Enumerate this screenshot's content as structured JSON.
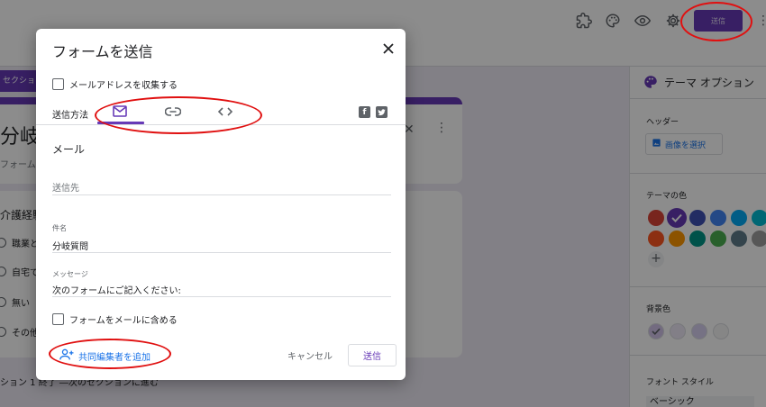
{
  "header": {
    "send_label": "送信",
    "icons": [
      "puzzle-icon",
      "palette-icon",
      "eye-icon",
      "gear-icon",
      "more-vert-icon"
    ]
  },
  "form": {
    "section_label": "セクション",
    "title": "分岐",
    "description": "フォームの",
    "question_title": "介護経験",
    "options": [
      "職業と",
      "自宅で",
      "無い",
      "その他"
    ],
    "section_note": "ション 1 終了 ―次のセクションに進む"
  },
  "theme_panel": {
    "title": "テーマ オプション",
    "header_label": "ヘッダー",
    "select_image_label": "画像を選択",
    "theme_color_label": "テーマの色",
    "theme_colors": [
      "#db4437",
      "#673ab7",
      "#3f51b5",
      "#4285f4",
      "#03a9f4",
      "#00bcd4",
      "#ff5722",
      "#ff9800",
      "#009688",
      "#4caf50",
      "#607d8b",
      "#9e9e9e"
    ],
    "selected_theme_color": "#673ab7",
    "bg_color_label": "背景色",
    "bg_colors": [
      "#d1c4e9",
      "#ede7f6",
      "#d7cff0",
      "#f5f5f5"
    ],
    "font_style_label": "フォント スタイル",
    "font_style_value": "ベーシック"
  },
  "dialog": {
    "title": "フォームを送信",
    "collect_email_label": "メールアドレスを収集する",
    "collect_email_checked": false,
    "send_via_label": "送信方法",
    "tabs": [
      "email-tab",
      "link-tab",
      "embed-tab"
    ],
    "active_tab": "email-tab",
    "section_heading": "メール",
    "to_placeholder": "送信先",
    "subject_label": "件名",
    "subject_value": "分岐質問",
    "message_label": "メッセージ",
    "message_value": "次のフォームにご記入ください:",
    "include_form_label": "フォームをメールに含める",
    "include_form_checked": false,
    "add_collaborators_label": "共同編集者を追加",
    "cancel_label": "キャンセル",
    "send_label": "送信"
  },
  "colors": {
    "accent": "#673ab7",
    "link": "#1a73e8",
    "annotation": "#e01010"
  }
}
